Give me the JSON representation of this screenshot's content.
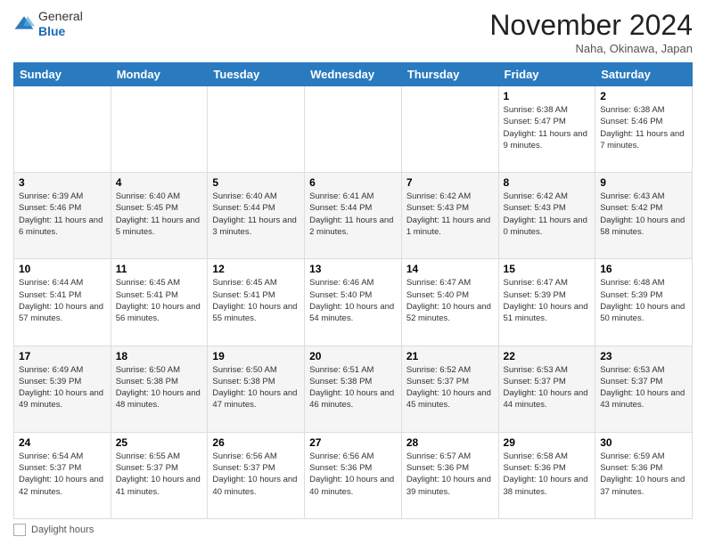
{
  "header": {
    "logo_general": "General",
    "logo_blue": "Blue",
    "month_title": "November 2024",
    "subtitle": "Naha, Okinawa, Japan"
  },
  "days_of_week": [
    "Sunday",
    "Monday",
    "Tuesday",
    "Wednesday",
    "Thursday",
    "Friday",
    "Saturday"
  ],
  "weeks": [
    [
      {
        "day": "",
        "info": ""
      },
      {
        "day": "",
        "info": ""
      },
      {
        "day": "",
        "info": ""
      },
      {
        "day": "",
        "info": ""
      },
      {
        "day": "",
        "info": ""
      },
      {
        "day": "1",
        "info": "Sunrise: 6:38 AM\nSunset: 5:47 PM\nDaylight: 11 hours and 9 minutes."
      },
      {
        "day": "2",
        "info": "Sunrise: 6:38 AM\nSunset: 5:46 PM\nDaylight: 11 hours and 7 minutes."
      }
    ],
    [
      {
        "day": "3",
        "info": "Sunrise: 6:39 AM\nSunset: 5:46 PM\nDaylight: 11 hours and 6 minutes."
      },
      {
        "day": "4",
        "info": "Sunrise: 6:40 AM\nSunset: 5:45 PM\nDaylight: 11 hours and 5 minutes."
      },
      {
        "day": "5",
        "info": "Sunrise: 6:40 AM\nSunset: 5:44 PM\nDaylight: 11 hours and 3 minutes."
      },
      {
        "day": "6",
        "info": "Sunrise: 6:41 AM\nSunset: 5:44 PM\nDaylight: 11 hours and 2 minutes."
      },
      {
        "day": "7",
        "info": "Sunrise: 6:42 AM\nSunset: 5:43 PM\nDaylight: 11 hours and 1 minute."
      },
      {
        "day": "8",
        "info": "Sunrise: 6:42 AM\nSunset: 5:43 PM\nDaylight: 11 hours and 0 minutes."
      },
      {
        "day": "9",
        "info": "Sunrise: 6:43 AM\nSunset: 5:42 PM\nDaylight: 10 hours and 58 minutes."
      }
    ],
    [
      {
        "day": "10",
        "info": "Sunrise: 6:44 AM\nSunset: 5:41 PM\nDaylight: 10 hours and 57 minutes."
      },
      {
        "day": "11",
        "info": "Sunrise: 6:45 AM\nSunset: 5:41 PM\nDaylight: 10 hours and 56 minutes."
      },
      {
        "day": "12",
        "info": "Sunrise: 6:45 AM\nSunset: 5:41 PM\nDaylight: 10 hours and 55 minutes."
      },
      {
        "day": "13",
        "info": "Sunrise: 6:46 AM\nSunset: 5:40 PM\nDaylight: 10 hours and 54 minutes."
      },
      {
        "day": "14",
        "info": "Sunrise: 6:47 AM\nSunset: 5:40 PM\nDaylight: 10 hours and 52 minutes."
      },
      {
        "day": "15",
        "info": "Sunrise: 6:47 AM\nSunset: 5:39 PM\nDaylight: 10 hours and 51 minutes."
      },
      {
        "day": "16",
        "info": "Sunrise: 6:48 AM\nSunset: 5:39 PM\nDaylight: 10 hours and 50 minutes."
      }
    ],
    [
      {
        "day": "17",
        "info": "Sunrise: 6:49 AM\nSunset: 5:39 PM\nDaylight: 10 hours and 49 minutes."
      },
      {
        "day": "18",
        "info": "Sunrise: 6:50 AM\nSunset: 5:38 PM\nDaylight: 10 hours and 48 minutes."
      },
      {
        "day": "19",
        "info": "Sunrise: 6:50 AM\nSunset: 5:38 PM\nDaylight: 10 hours and 47 minutes."
      },
      {
        "day": "20",
        "info": "Sunrise: 6:51 AM\nSunset: 5:38 PM\nDaylight: 10 hours and 46 minutes."
      },
      {
        "day": "21",
        "info": "Sunrise: 6:52 AM\nSunset: 5:37 PM\nDaylight: 10 hours and 45 minutes."
      },
      {
        "day": "22",
        "info": "Sunrise: 6:53 AM\nSunset: 5:37 PM\nDaylight: 10 hours and 44 minutes."
      },
      {
        "day": "23",
        "info": "Sunrise: 6:53 AM\nSunset: 5:37 PM\nDaylight: 10 hours and 43 minutes."
      }
    ],
    [
      {
        "day": "24",
        "info": "Sunrise: 6:54 AM\nSunset: 5:37 PM\nDaylight: 10 hours and 42 minutes."
      },
      {
        "day": "25",
        "info": "Sunrise: 6:55 AM\nSunset: 5:37 PM\nDaylight: 10 hours and 41 minutes."
      },
      {
        "day": "26",
        "info": "Sunrise: 6:56 AM\nSunset: 5:37 PM\nDaylight: 10 hours and 40 minutes."
      },
      {
        "day": "27",
        "info": "Sunrise: 6:56 AM\nSunset: 5:36 PM\nDaylight: 10 hours and 40 minutes."
      },
      {
        "day": "28",
        "info": "Sunrise: 6:57 AM\nSunset: 5:36 PM\nDaylight: 10 hours and 39 minutes."
      },
      {
        "day": "29",
        "info": "Sunrise: 6:58 AM\nSunset: 5:36 PM\nDaylight: 10 hours and 38 minutes."
      },
      {
        "day": "30",
        "info": "Sunrise: 6:59 AM\nSunset: 5:36 PM\nDaylight: 10 hours and 37 minutes."
      }
    ]
  ],
  "legend": {
    "box_label": "Daylight hours"
  }
}
